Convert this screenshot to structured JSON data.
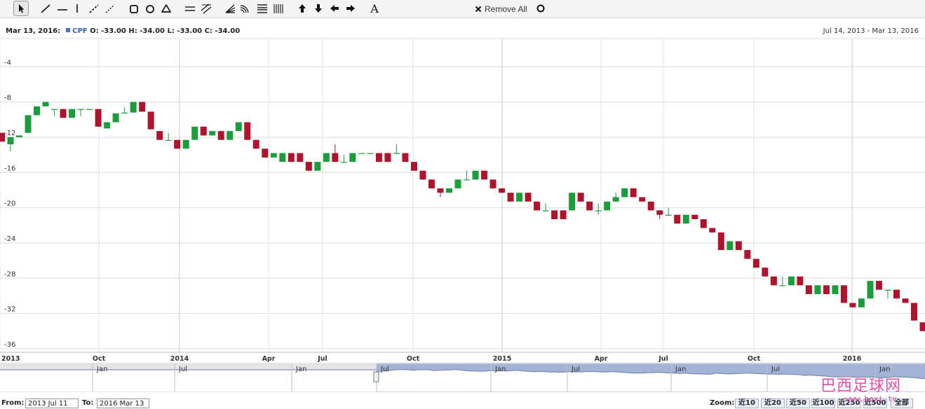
{
  "toolbar": {
    "icons": [
      "cursor-icon",
      "line-icon",
      "horizontal-line-icon",
      "vertical-line-icon",
      "dashed-line-icon",
      "ray-icon",
      "rectangle-icon",
      "circle-icon",
      "triangle-icon",
      "channel-icon",
      "trend-channel-icon",
      "fan-icon",
      "arc-icon",
      "fibonacci-icon",
      "cycle-lines-icon",
      "arrow-up-icon",
      "arrow-down-icon",
      "arrow-left-icon",
      "arrow-right-icon",
      "text-icon",
      "close-icon",
      "circle-outline-icon"
    ],
    "remove_all_label": "Remove All"
  },
  "info": {
    "date": "Mar 13, 2016:",
    "symbol": "CPF",
    "ohlc": "O: -33.00  H: -34.00  L: -33.00  C: -34.00",
    "range": "Jul 14, 2013 - Mar 13, 2016"
  },
  "colors": {
    "up": "#1a9e3a",
    "down": "#b0142c",
    "grid": "#dedede",
    "navigator": "#a3b3d6"
  },
  "chart_data": {
    "type": "candlestick",
    "title": "",
    "xlabel": "",
    "ylabel": "",
    "ylim": [
      -36.4,
      -0.8
    ],
    "y_ticks": [
      -4,
      -8,
      -12,
      -16,
      -20,
      -24,
      -28,
      -32,
      -36
    ],
    "x_ticks": [
      "2013",
      "Oct",
      "2014",
      "Apr",
      "Jul",
      "Oct",
      "2015",
      "Apr",
      "Jul",
      "Oct",
      "2016"
    ],
    "grid": true,
    "legend": "none",
    "up_color": "#1a9e3a",
    "down_color": "#b0142c",
    "candles": [
      {
        "o": -11.5,
        "c": -12.5,
        "h": -11.5,
        "l": -12.5
      },
      {
        "o": -12.8,
        "c": -12.0,
        "h": -12.0,
        "l": -13.6
      },
      {
        "o": -12.0,
        "c": -11.8,
        "h": -11.8,
        "l": -12.0
      },
      {
        "o": -11.5,
        "c": -9.5,
        "h": -9.5,
        "l": -11.5
      },
      {
        "o": -9.5,
        "c": -8.5,
        "h": -8.5,
        "l": -9.5
      },
      {
        "o": -8.5,
        "c": -8.0,
        "h": -8.0,
        "l": -8.5
      },
      {
        "o": -8.8,
        "c": -8.8,
        "h": -8.8,
        "l": -9.6
      },
      {
        "o": -8.8,
        "c": -9.8,
        "h": -8.8,
        "l": -9.8
      },
      {
        "o": -9.8,
        "c": -8.8,
        "h": -8.8,
        "l": -9.8
      },
      {
        "o": -8.8,
        "c": -8.8,
        "h": -8.8,
        "l": -9.6
      },
      {
        "o": -8.8,
        "c": -8.8,
        "h": -8.8,
        "l": -8.8
      },
      {
        "o": -8.8,
        "c": -10.8,
        "h": -8.8,
        "l": -10.8
      },
      {
        "o": -11.0,
        "c": -10.3,
        "h": -10.3,
        "l": -11.0
      },
      {
        "o": -10.3,
        "c": -9.3,
        "h": -9.3,
        "l": -10.3
      },
      {
        "o": -9.2,
        "c": -9.2,
        "h": -8.6,
        "l": -9.2
      },
      {
        "o": -9.2,
        "c": -8.0,
        "h": -8.0,
        "l": -9.2
      },
      {
        "o": -8.0,
        "c": -9.1,
        "h": -8.0,
        "l": -9.1
      },
      {
        "o": -9.1,
        "c": -11.1,
        "h": -9.1,
        "l": -11.1
      },
      {
        "o": -11.3,
        "c": -12.3,
        "h": -11.3,
        "l": -12.3
      },
      {
        "o": -12.3,
        "c": -12.3,
        "h": -11.5,
        "l": -12.3
      },
      {
        "o": -12.3,
        "c": -13.3,
        "h": -12.3,
        "l": -13.3
      },
      {
        "o": -13.3,
        "c": -12.3,
        "h": -12.3,
        "l": -13.3
      },
      {
        "o": -12.3,
        "c": -10.8,
        "h": -10.8,
        "l": -12.3
      },
      {
        "o": -10.8,
        "c": -11.8,
        "h": -10.8,
        "l": -11.8
      },
      {
        "o": -11.8,
        "c": -11.3,
        "h": -11.3,
        "l": -11.8
      },
      {
        "o": -11.3,
        "c": -12.3,
        "h": -11.3,
        "l": -12.3
      },
      {
        "o": -12.3,
        "c": -11.3,
        "h": -11.3,
        "l": -12.3
      },
      {
        "o": -11.3,
        "c": -10.3,
        "h": -10.3,
        "l": -11.3
      },
      {
        "o": -10.3,
        "c": -12.3,
        "h": -10.3,
        "l": -12.3
      },
      {
        "o": -12.3,
        "c": -13.3,
        "h": -12.3,
        "l": -13.3
      },
      {
        "o": -13.3,
        "c": -14.3,
        "h": -13.3,
        "l": -14.3
      },
      {
        "o": -14.3,
        "c": -13.8,
        "h": -13.8,
        "l": -14.3
      },
      {
        "o": -14.8,
        "c": -13.8,
        "h": -13.8,
        "l": -14.8
      },
      {
        "o": -13.8,
        "c": -14.8,
        "h": -13.8,
        "l": -14.8
      },
      {
        "o": -13.8,
        "c": -14.8,
        "h": -13.8,
        "l": -14.8
      },
      {
        "o": -14.8,
        "c": -15.8,
        "h": -14.8,
        "l": -15.8
      },
      {
        "o": -15.8,
        "c": -14.8,
        "h": -14.8,
        "l": -15.8
      },
      {
        "o": -14.8,
        "c": -13.8,
        "h": -13.8,
        "l": -14.8
      },
      {
        "o": -13.8,
        "c": -14.8,
        "h": -12.8,
        "l": -14.8
      },
      {
        "o": -14.8,
        "c": -14.8,
        "h": -14.0,
        "l": -14.8
      },
      {
        "o": -14.8,
        "c": -13.8,
        "h": -13.8,
        "l": -14.8
      },
      {
        "o": -13.8,
        "c": -13.8,
        "h": -13.8,
        "l": -13.8
      },
      {
        "o": -13.8,
        "c": -13.8,
        "h": -13.8,
        "l": -13.8
      },
      {
        "o": -13.8,
        "c": -14.8,
        "h": -13.8,
        "l": -14.8
      },
      {
        "o": -13.8,
        "c": -14.8,
        "h": -13.8,
        "l": -14.8
      },
      {
        "o": -13.8,
        "c": -13.8,
        "h": -12.8,
        "l": -13.8
      },
      {
        "o": -13.8,
        "c": -14.8,
        "h": -13.8,
        "l": -14.8
      },
      {
        "o": -14.8,
        "c": -15.8,
        "h": -14.8,
        "l": -15.8
      },
      {
        "o": -15.8,
        "c": -16.8,
        "h": -15.8,
        "l": -16.8
      },
      {
        "o": -16.8,
        "c": -17.8,
        "h": -16.8,
        "l": -17.8
      },
      {
        "o": -17.8,
        "c": -18.3,
        "h": -17.8,
        "l": -18.8
      },
      {
        "o": -18.3,
        "c": -17.8,
        "h": -17.8,
        "l": -18.3
      },
      {
        "o": -17.8,
        "c": -16.8,
        "h": -16.8,
        "l": -17.8
      },
      {
        "o": -16.8,
        "c": -16.8,
        "h": -15.8,
        "l": -16.8
      },
      {
        "o": -16.8,
        "c": -15.8,
        "h": -15.8,
        "l": -16.8
      },
      {
        "o": -15.8,
        "c": -16.8,
        "h": -15.8,
        "l": -16.8
      },
      {
        "o": -16.8,
        "c": -17.8,
        "h": -16.8,
        "l": -17.8
      },
      {
        "o": -17.8,
        "c": -18.3,
        "h": -17.8,
        "l": -18.3
      },
      {
        "o": -18.3,
        "c": -19.3,
        "h": -18.3,
        "l": -19.3
      },
      {
        "o": -19.3,
        "c": -18.3,
        "h": -18.3,
        "l": -19.3
      },
      {
        "o": -18.3,
        "c": -19.3,
        "h": -18.3,
        "l": -19.3
      },
      {
        "o": -19.3,
        "c": -20.3,
        "h": -19.3,
        "l": -20.3
      },
      {
        "o": -20.3,
        "c": -20.3,
        "h": -19.5,
        "l": -20.3
      },
      {
        "o": -20.3,
        "c": -21.3,
        "h": -20.3,
        "l": -21.3
      },
      {
        "o": -20.3,
        "c": -21.3,
        "h": -20.3,
        "l": -21.3
      },
      {
        "o": -20.3,
        "c": -18.3,
        "h": -18.3,
        "l": -20.3
      },
      {
        "o": -18.3,
        "c": -19.3,
        "h": -18.3,
        "l": -19.3
      },
      {
        "o": -19.3,
        "c": -20.3,
        "h": -19.3,
        "l": -20.3
      },
      {
        "o": -20.3,
        "c": -20.3,
        "h": -19.5,
        "l": -20.8
      },
      {
        "o": -20.3,
        "c": -19.3,
        "h": -19.3,
        "l": -20.3
      },
      {
        "o": -19.3,
        "c": -18.8,
        "h": -18.3,
        "l": -19.3
      },
      {
        "o": -18.8,
        "c": -17.8,
        "h": -17.8,
        "l": -18.8
      },
      {
        "o": -17.8,
        "c": -18.8,
        "h": -17.8,
        "l": -18.8
      },
      {
        "o": -18.8,
        "c": -19.3,
        "h": -18.8,
        "l": -19.3
      },
      {
        "o": -19.3,
        "c": -20.3,
        "h": -19.3,
        "l": -20.3
      },
      {
        "o": -20.3,
        "c": -20.8,
        "h": -20.3,
        "l": -21.3
      },
      {
        "o": -20.8,
        "c": -20.8,
        "h": -20.0,
        "l": -20.8
      },
      {
        "o": -20.8,
        "c": -21.8,
        "h": -20.8,
        "l": -21.8
      },
      {
        "o": -21.8,
        "c": -20.8,
        "h": -20.8,
        "l": -21.8
      },
      {
        "o": -20.8,
        "c": -21.3,
        "h": -20.8,
        "l": -21.3
      },
      {
        "o": -21.3,
        "c": -22.3,
        "h": -21.3,
        "l": -22.3
      },
      {
        "o": -22.3,
        "c": -22.8,
        "h": -22.3,
        "l": -22.8
      },
      {
        "o": -22.8,
        "c": -24.8,
        "h": -22.8,
        "l": -24.8
      },
      {
        "o": -24.8,
        "c": -23.8,
        "h": -23.8,
        "l": -24.8
      },
      {
        "o": -23.8,
        "c": -24.8,
        "h": -23.8,
        "l": -24.8
      },
      {
        "o": -24.8,
        "c": -25.8,
        "h": -24.8,
        "l": -25.8
      },
      {
        "o": -25.8,
        "c": -26.8,
        "h": -25.8,
        "l": -26.8
      },
      {
        "o": -26.8,
        "c": -27.8,
        "h": -26.8,
        "l": -27.8
      },
      {
        "o": -27.8,
        "c": -28.8,
        "h": -27.8,
        "l": -28.8
      },
      {
        "o": -28.8,
        "c": -28.8,
        "h": -27.8,
        "l": -28.8
      },
      {
        "o": -28.8,
        "c": -27.8,
        "h": -27.8,
        "l": -28.8
      },
      {
        "o": -27.8,
        "c": -28.8,
        "h": -27.8,
        "l": -28.8
      },
      {
        "o": -28.8,
        "c": -29.8,
        "h": -28.8,
        "l": -29.8
      },
      {
        "o": -29.8,
        "c": -28.8,
        "h": -28.8,
        "l": -29.8
      },
      {
        "o": -28.8,
        "c": -29.8,
        "h": -28.8,
        "l": -29.8
      },
      {
        "o": -29.8,
        "c": -28.8,
        "h": -28.8,
        "l": -29.8
      },
      {
        "o": -28.8,
        "c": -30.8,
        "h": -28.8,
        "l": -30.8
      },
      {
        "o": -30.8,
        "c": -31.3,
        "h": -30.8,
        "l": -31.3
      },
      {
        "o": -31.3,
        "c": -30.3,
        "h": -30.3,
        "l": -31.3
      },
      {
        "o": -30.3,
        "c": -28.3,
        "h": -28.3,
        "l": -30.3
      },
      {
        "o": -28.3,
        "c": -29.3,
        "h": -28.3,
        "l": -29.3
      },
      {
        "o": -29.3,
        "c": -29.3,
        "h": -29.3,
        "l": -30.3
      },
      {
        "o": -29.3,
        "c": -30.3,
        "h": -29.3,
        "l": -30.3
      },
      {
        "o": -30.3,
        "c": -30.8,
        "h": -30.3,
        "l": -30.8
      },
      {
        "o": -30.8,
        "c": -32.8,
        "h": -30.8,
        "l": -32.8
      },
      {
        "o": -33.0,
        "c": -34.0,
        "h": -33.0,
        "l": -34.0
      }
    ]
  },
  "navigator": {
    "labels": [
      "Jan",
      "Jul",
      "Jan",
      "Jul",
      "Jan",
      "Jul",
      "Jan",
      "Jul",
      "Jan"
    ]
  },
  "bottom": {
    "from_label": "From:",
    "from_value": "2013 Jul 11",
    "to_label": "To:",
    "to_value": "2016 Mar 13",
    "zoom_label": "Zoom:",
    "zoom_buttons": [
      "近10",
      "近20",
      "近50",
      "近100",
      "近250",
      "近500",
      "全部"
    ]
  },
  "watermark": {
    "cn": "巴西足球网",
    "url": "www.baxi.tv"
  }
}
